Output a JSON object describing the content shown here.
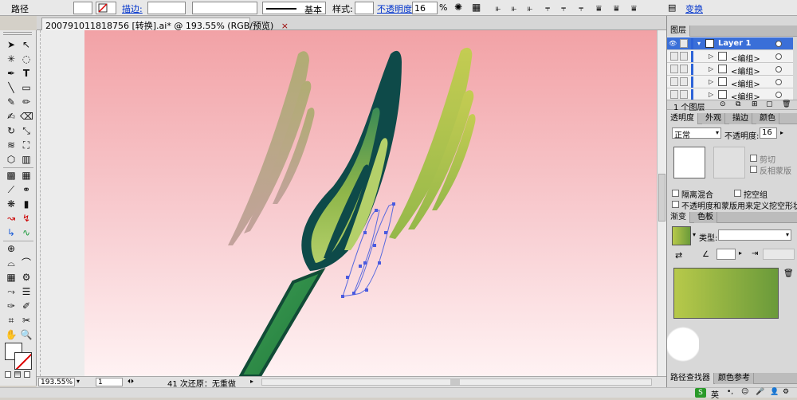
{
  "control_bar": {
    "object_type": "路径",
    "stroke_label": "描边:",
    "stroke_profile": "基本",
    "style_label": "样式:",
    "opacity_label": "不透明度:",
    "opacity_value": "16",
    "opacity_unit": "%",
    "transform_label": "变换",
    "dropdown_arrow": "▾",
    "stepper_arrow": "▸"
  },
  "document": {
    "tab_title": "200791011818756 [转换].ai* @ 193.55% (RGB/预览)",
    "close_symbol": "×"
  },
  "status_bar": {
    "zoom": "193.55%",
    "page": "1",
    "status_text": "41 次还原：无重做"
  },
  "layers_panel": {
    "title": "图层",
    "layers": [
      {
        "label": "Layer 1",
        "active": true
      },
      {
        "label": "<编组>",
        "active": false
      },
      {
        "label": "<编组>",
        "active": false
      },
      {
        "label": "<编组>",
        "active": false
      },
      {
        "label": "<编组>",
        "active": false
      }
    ],
    "footer": "1 个图层"
  },
  "transparency_panel": {
    "tabs": [
      "透明度",
      "外观",
      "描边",
      "颜色"
    ],
    "blend_mode": "正常",
    "opacity_label": "不透明度:",
    "opacity_value": "16",
    "clip_label": "剪切",
    "invert_mask_label": "反相蒙版",
    "isolate_label": "隔离混合",
    "knockout_label": "挖空组",
    "opacity_mask_label": "不透明度和蒙版用来定义挖空形状"
  },
  "gradient_panel": {
    "tabs": [
      "渐变",
      "色板"
    ],
    "type_label": "类型:",
    "gradient_colors": [
      "#b7c94a",
      "#6a9a3a"
    ]
  },
  "bottom_panels": {
    "tabs": [
      "路径查找器",
      "颜色参考"
    ]
  },
  "taskbar": {
    "ime_label": "英"
  },
  "colors": {
    "selection_blue": "#4a5adf",
    "leaf_dark": "#0d4b4a",
    "leaf_light_green": "#a9c454",
    "stem_green": "#2d8a45",
    "artboard_top": "#f2a2a6",
    "artboard_bottom": "#fff2f3"
  }
}
